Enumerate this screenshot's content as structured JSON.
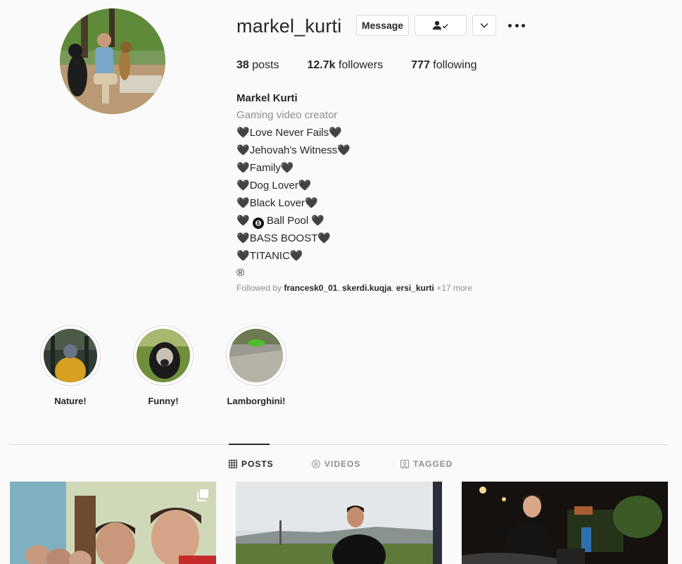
{
  "profile": {
    "username": "markel_kurti",
    "buttons": {
      "message": "Message"
    },
    "stats": {
      "posts_count": "38",
      "posts_label": "posts",
      "followers_count": "12.7k",
      "followers_label": "followers",
      "following_count": "777",
      "following_label": "following"
    },
    "full_name": "Markel Kurti",
    "category": "Gaming video creator",
    "bio_lines": [
      "Love Never Fails",
      "Jehovah's Witness",
      "Family",
      "Dog Lover",
      "Black Lover",
      "Ball Pool",
      "BASS BOOST",
      "TITANIC",
      "®"
    ],
    "followed_by": {
      "prefix": "Followed by",
      "users": [
        "francesk0_01",
        "skerdi.kuqja",
        "ersi_kurti"
      ],
      "more": "+17 more"
    }
  },
  "highlights": [
    {
      "label": "Nature!"
    },
    {
      "label": "Funny!"
    },
    {
      "label": "Lamborghini!"
    }
  ],
  "tabs": [
    {
      "label": "POSTS",
      "icon": "grid-icon"
    },
    {
      "label": "VIDEOS",
      "icon": "play-circle-icon"
    },
    {
      "label": "TAGGED",
      "icon": "tag-user-icon"
    }
  ],
  "colors": {
    "text": "#262626",
    "secondary": "#8e8e8e",
    "border": "#dbdbdb",
    "background": "#fafafa"
  }
}
